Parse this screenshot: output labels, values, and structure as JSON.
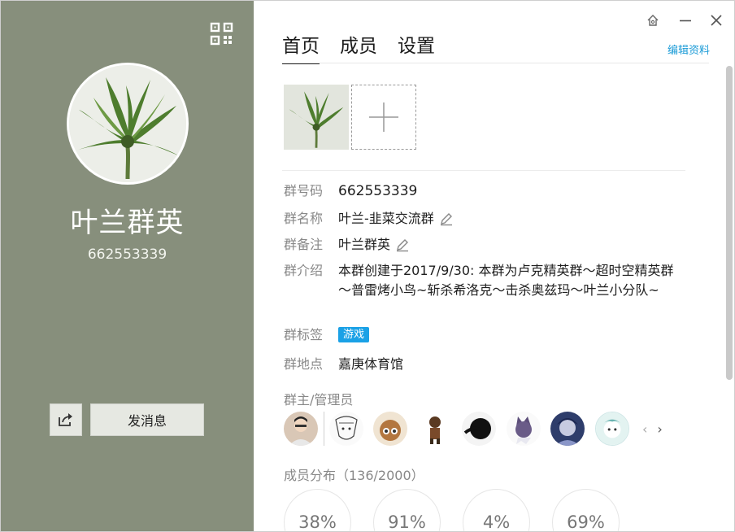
{
  "profile": {
    "name": "叶兰群英",
    "number": "662553339",
    "send_message": "发消息"
  },
  "tabs": [
    {
      "label": "首页",
      "active": true
    },
    {
      "label": "成员",
      "active": false
    },
    {
      "label": "设置",
      "active": false
    }
  ],
  "edit_profile": "编辑资料",
  "info": {
    "number_label": "群号码",
    "number_value": "662553339",
    "name_label": "群名称",
    "name_value": "叶兰-韭菜交流群",
    "remark_label": "群备注",
    "remark_value": "叶兰群英",
    "intro_label": "群介绍",
    "intro_value": "本群创建于2017/9/30: 本群为卢克精英群～超时空精英群～普雷烤小鸟~斩杀希洛克～击杀奥兹玛～叶兰小分队~",
    "tag_label": "群标签",
    "tag_value": "游戏",
    "location_label": "群地点",
    "location_value": "嘉庚体育馆"
  },
  "admins_label": "群主/管理员",
  "distribution": {
    "label": "成员分布（136/2000）",
    "percents": [
      "38%",
      "91%",
      "4%",
      "69%"
    ]
  },
  "colors": {
    "left_panel": "#878f7c",
    "accent_link": "#1a9bd7",
    "tag_bg": "#1aa1e6"
  },
  "icons": {
    "qr": "qr-code-icon",
    "share": "share-icon",
    "pencil": "pencil-icon",
    "add": "plus-icon"
  }
}
